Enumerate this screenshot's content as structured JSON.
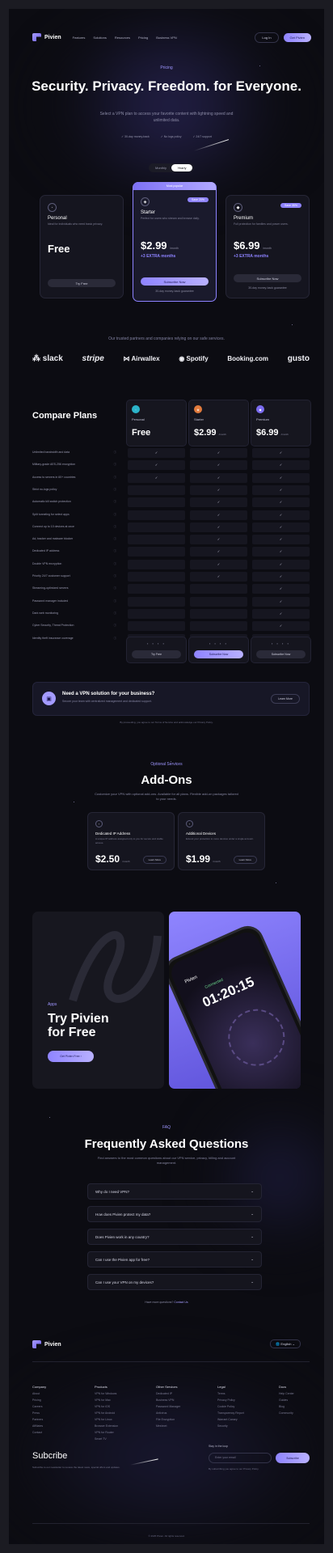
{
  "colors": {
    "accent": "#8f84ff",
    "bg": "#0c0c12",
    "card": "#15151f"
  },
  "nav": {
    "brand": "Pivien",
    "links": [
      "Features",
      "Solutions",
      "Resources",
      "Pricing",
      "Business VPN"
    ],
    "login": "Log In",
    "cta": "Get Pivien"
  },
  "hero": {
    "eyebrow": "Pricing",
    "title": "Security. Privacy. Freedom. for Everyone.",
    "subtitle": "Select a VPN plan to access your favorite content with lightning speed and unlimited data.",
    "features": [
      "30-day money-back",
      "No logs policy",
      "24/7 support"
    ]
  },
  "billing_toggle": {
    "options": [
      "Monthly",
      "Yearly"
    ],
    "selected": "Yearly"
  },
  "plans": [
    {
      "name": "Personal",
      "desc": "Ideal for individuals who need basic privacy.",
      "price": "Free",
      "extra": "",
      "button": "Try Free",
      "note": ""
    },
    {
      "tag": "Most popular",
      "name": "Starter",
      "badge": "Save 20%",
      "desc": "Perfect for users who stream and browse daily.",
      "price": "$2.99",
      "unit": "/month",
      "extra": "+3 EXTRA months",
      "button": "Subscribe Now",
      "note": "30-day money-back guarantee"
    },
    {
      "name": "Premium",
      "badge": "Save 35%",
      "desc": "Full protection for families and power users.",
      "price": "$6.99",
      "unit": "/month",
      "extra": "+3 EXTRA months",
      "button": "Subscribe Now",
      "note": "30-day money-back guarantee"
    }
  ],
  "partners": {
    "caption": "Our trusted partners and companies relying on our safe services.",
    "logos": [
      "slack",
      "stripe",
      "Airwallex",
      "Spotify",
      "Booking.com",
      "gusto"
    ]
  },
  "compare": {
    "title": "Compare Plans",
    "columns": [
      {
        "name": "Personal",
        "price": "Free",
        "unit": ""
      },
      {
        "name": "Starter",
        "price": "$2.99",
        "unit": "/month"
      },
      {
        "name": "Premium",
        "price": "$6.99",
        "unit": "/month"
      }
    ],
    "features": [
      "Unlimited bandwidth and data",
      "Military-grade AES-256 encryption",
      "Access to servers in 60+ countries",
      "Strict no-logs policy",
      "Automatic kill switch protection",
      "Split tunneling for select apps",
      "Connect up to 10 devices at once",
      "Ad, tracker and malware blocker",
      "Dedicated IP address",
      "Double VPN encryption",
      "Priority 24/7 customer support",
      "Streaming-optimized servers",
      "Password manager included",
      "Dark web monitoring",
      "Cyber Security, Threat Protection",
      "Identity theft insurance coverage"
    ],
    "buttons": [
      "Try Free",
      "Subscribe Now",
      "Subscribe Now"
    ]
  },
  "business": {
    "title": "Need a VPN solution for your business?",
    "subtitle": "Secure your team with centralized management and dedicated support.",
    "button": "Learn More"
  },
  "legal": "By proceeding, you agree to our Terms of Service and acknowledge our Privacy Policy.",
  "addons": {
    "eyebrow": "Optional Services",
    "title": "Add-Ons",
    "subtitle": "Customize your VPN with optional add-ons. Available for all plans. Flexible add-on packages tailored to your needs.",
    "items": [
      {
        "name": "Dedicated IP Address",
        "desc": "A unique IP address assigned only to you for secure and stable access.",
        "price": "$2.50",
        "unit": "/month",
        "button": "Learn More"
      },
      {
        "name": "Additional Devices",
        "desc": "Extend your protection to more devices under a single account.",
        "price": "$1.99",
        "unit": "/month",
        "button": "Learn More"
      }
    ]
  },
  "promo": {
    "eyebrow": "Apps",
    "title": "Try Pivien for Free",
    "button": "Get Pivien Free",
    "phone_time": "01:20:15",
    "phone_status": "Connected",
    "phone_brand": "Pivien"
  },
  "faq": {
    "eyebrow": "FAQ",
    "title": "Frequently Asked Questions",
    "subtitle": "Find answers to the most common questions about our VPN service, privacy, billing and account management.",
    "items": [
      "Why do I need VPN?",
      "How does Pivien protect my data?",
      "Does Pivien work in any country?",
      "Can I use the Pivien app for free?",
      "Can I use your VPN on my devices?"
    ],
    "more_prefix": "Have more questions?",
    "more_link": "Contact Us"
  },
  "footer": {
    "brand": "Pivien",
    "language": "English",
    "columns": [
      {
        "heading": "Company",
        "links": [
          "About",
          "Pricing",
          "Careers",
          "Press",
          "Partners",
          "Affiliates",
          "Contact"
        ]
      },
      {
        "heading": "Products",
        "links": [
          "VPN for Windows",
          "VPN for Mac",
          "VPN for iOS",
          "VPN for Android",
          "VPN for Linux",
          "Browser Extension",
          "VPN for Router",
          "Smart TV"
        ]
      },
      {
        "heading": "Other Services",
        "links": [
          "Dedicated IP",
          "Business VPN",
          "Password Manager",
          "Antivirus",
          "File Encryption",
          "Meshnet"
        ]
      },
      {
        "heading": "Legal",
        "links": [
          "Terms",
          "Privacy Policy",
          "Cookie Policy",
          "Transparency Report",
          "Warrant Canary",
          "Security"
        ]
      },
      {
        "heading": "Docs",
        "links": [
          "Help Center",
          "Guides",
          "Blog",
          "Community"
        ]
      }
    ],
    "subscribe": {
      "title": "Subcribe",
      "desc": "Subscribe to our newsletter to receive the latest news, special offers and updates.",
      "label": "Stay in the loop",
      "placeholder": "Enter your email",
      "button": "Subscribe",
      "note": "By subscribing you agree to our Privacy Policy."
    },
    "copyright": "© 2025 Pivien. All rights reserved."
  }
}
